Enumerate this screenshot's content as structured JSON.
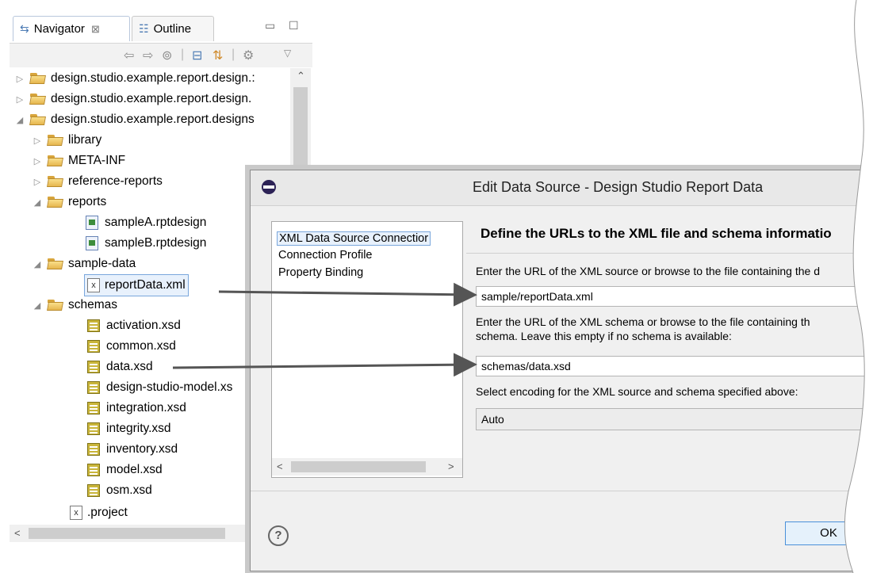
{
  "navigator": {
    "tab_navigator": "Navigator",
    "tab_close": "⊠",
    "tab_outline": "Outline",
    "minimize": "▭",
    "maximize": "☐",
    "tree": [
      {
        "label": "design.studio.example.report.design.:",
        "type": "project",
        "expanded": false
      },
      {
        "label": "design.studio.example.report.design.",
        "type": "project",
        "expanded": false
      },
      {
        "label": "design.studio.example.report.designs",
        "type": "project",
        "expanded": true
      },
      {
        "label": "library",
        "type": "folder",
        "expanded": false
      },
      {
        "label": "META-INF",
        "type": "folder",
        "expanded": false
      },
      {
        "label": "reference-reports",
        "type": "folder",
        "expanded": false
      },
      {
        "label": "reports",
        "type": "folder",
        "expanded": true
      },
      {
        "label": "sampleA.rptdesign",
        "type": "rptdesign"
      },
      {
        "label": "sampleB.rptdesign",
        "type": "rptdesign"
      },
      {
        "label": "sample-data",
        "type": "folder",
        "expanded": true
      },
      {
        "label": "reportData.xml",
        "type": "xml",
        "selected": true
      },
      {
        "label": "schemas",
        "type": "folder",
        "expanded": true
      },
      {
        "label": "activation.xsd",
        "type": "xsd"
      },
      {
        "label": "common.xsd",
        "type": "xsd"
      },
      {
        "label": "data.xsd",
        "type": "xsd"
      },
      {
        "label": "design-studio-model.xs",
        "type": "xsd"
      },
      {
        "label": "integration.xsd",
        "type": "xsd"
      },
      {
        "label": "integrity.xsd",
        "type": "xsd"
      },
      {
        "label": "inventory.xsd",
        "type": "xsd"
      },
      {
        "label": "model.xsd",
        "type": "xsd"
      },
      {
        "label": "osm.xsd",
        "type": "xsd"
      },
      {
        "label": ".project",
        "type": "xml"
      }
    ]
  },
  "dialog": {
    "title": "Edit Data Source - Design Studio Report Data",
    "side_items": [
      "XML Data Source Connectior",
      "Connection Profile",
      "Property Binding"
    ],
    "heading": "Define the URLs to the XML file and schema informatio",
    "xml_source_label": "Enter the URL of the XML source or browse to the file containing the d",
    "xml_source_value": "sample/reportData.xml",
    "schema_label_1": "Enter the URL of the XML schema or browse to the file containing th",
    "schema_label_2": "schema. Leave this empty if no schema is available:",
    "schema_value": "schemas/data.xsd",
    "encoding_label": "Select encoding for the XML source and schema specified above:",
    "encoding_value": "Auto",
    "help": "?",
    "ok": "OK"
  }
}
